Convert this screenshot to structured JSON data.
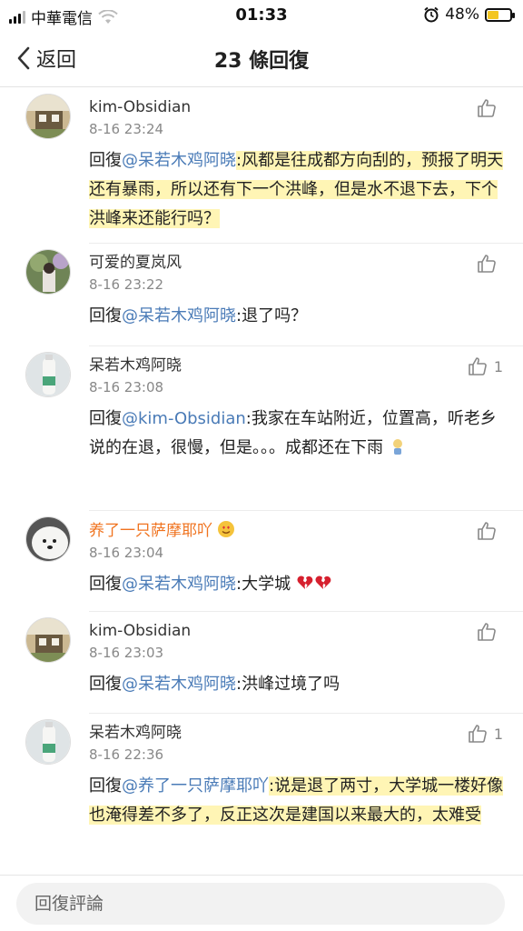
{
  "status": {
    "carrier": "中華電信",
    "time": "01:33",
    "battery": "48%"
  },
  "nav": {
    "back_label": "返回",
    "title": "23 條回復"
  },
  "comments": [
    {
      "name": "kim-Obsidian",
      "time": "8-16 23:24",
      "likes": "",
      "prefix": "回復",
      "mention": "@呆若木鸡阿晓",
      "text": ":风都是往成都方向刮的，预报了明天还有暴雨，所以还有下一个洪峰，但是水不退下去，下个洪峰来还能行吗？"
    },
    {
      "name": "可爱的夏岚风",
      "time": "8-16 23:22",
      "likes": "",
      "prefix": "回復",
      "mention": "@呆若木鸡阿晓",
      "text": ":退了吗？"
    },
    {
      "name": "呆若木鸡阿晓",
      "time": "8-16 23:08",
      "likes": "1",
      "prefix": "回復",
      "mention": "@kim-Obsidian",
      "text": ":我家在车站附近，位置高，听老乡说的在退，很慢，但是。。。成都还在下雨"
    },
    {
      "name": "养了一只萨摩耶吖",
      "time": "8-16 23:04",
      "likes": "",
      "prefix": "回復",
      "mention": "@呆若木鸡阿晓",
      "text": ":大学城"
    },
    {
      "name": "kim-Obsidian",
      "time": "8-16 23:03",
      "likes": "",
      "prefix": "回復",
      "mention": "@呆若木鸡阿晓",
      "text": ":洪峰过境了吗"
    },
    {
      "name": "呆若木鸡阿晓",
      "time": "8-16 22:36",
      "likes": "1",
      "prefix": "回復",
      "mention": "@养了一只萨摩耶吖",
      "text": ":说是退了两寸，大学城一楼好像也淹得差不多了，反正这次是建国以来最大的，太难受"
    }
  ],
  "input": {
    "placeholder": "回復評論"
  },
  "colors": {
    "mention": "#4a7bb7",
    "orange_name": "#f0731f",
    "highlight": "#ffec78"
  }
}
